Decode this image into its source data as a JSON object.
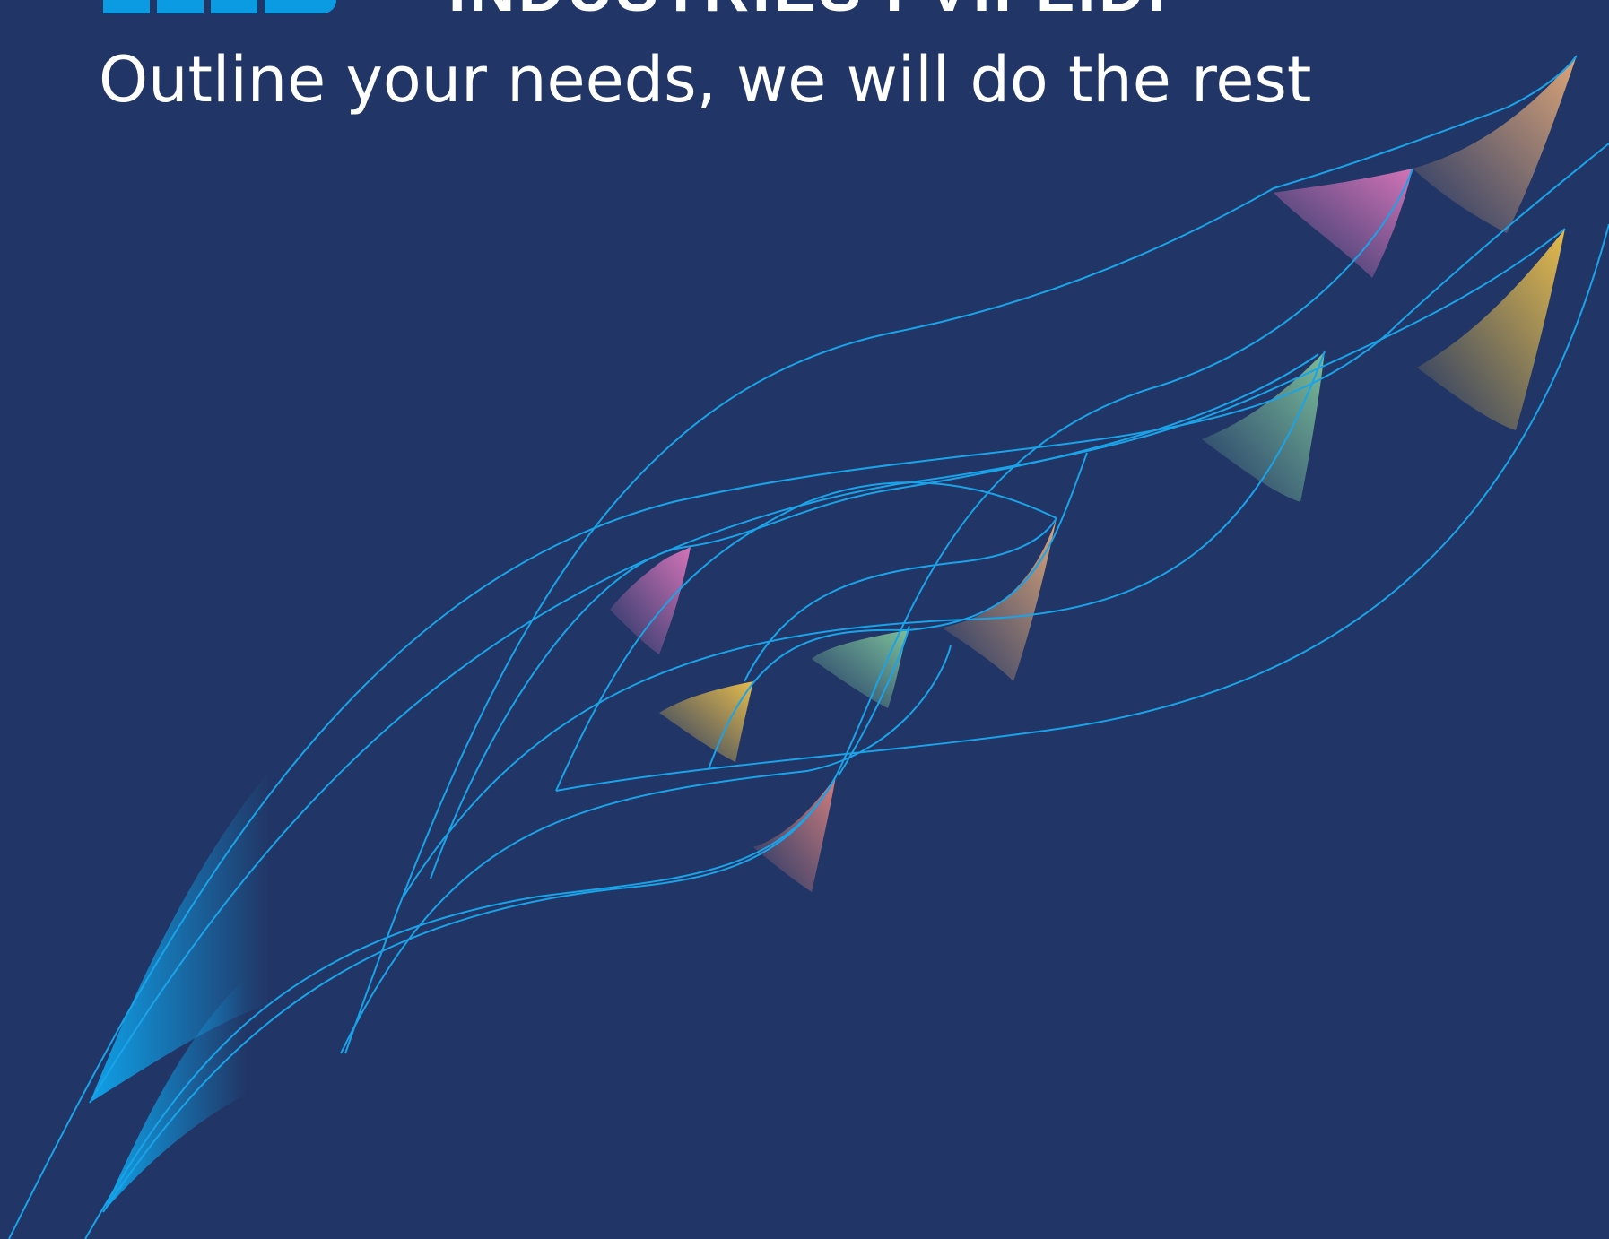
{
  "header": {
    "title_partial": "INDUSTRIES FVIFLIDI",
    "tagline": "Outline your needs, we will do the rest"
  },
  "colors": {
    "background": "#213666",
    "line": "#1aa3e8",
    "logo": "#0b9be3",
    "text": "#ffffff"
  },
  "decoration": {
    "description_icon": "flowing-ribbon-lines-graphic"
  }
}
